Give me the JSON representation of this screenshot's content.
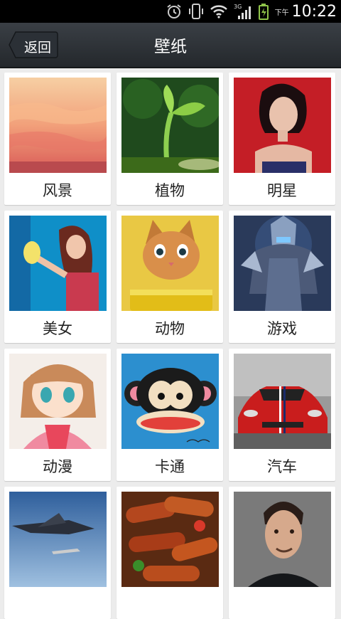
{
  "status_bar": {
    "ampm": "下午",
    "time": "10:22",
    "network": "3G",
    "icons": [
      "alarm-icon",
      "vibrate-icon",
      "wifi-icon",
      "signal-icon",
      "battery-icon"
    ]
  },
  "header": {
    "back_label": "返回",
    "title": "壁纸"
  },
  "categories": [
    {
      "label": "风景",
      "thumb": "sunset-landscape"
    },
    {
      "label": "植物",
      "thumb": "seedling-sprout"
    },
    {
      "label": "明星",
      "thumb": "celebrity-woman"
    },
    {
      "label": "美女",
      "thumb": "smiling-woman"
    },
    {
      "label": "动物",
      "thumb": "kitten"
    },
    {
      "label": "游戏",
      "thumb": "game-warrior"
    },
    {
      "label": "动漫",
      "thumb": "anime-girl"
    },
    {
      "label": "卡通",
      "thumb": "cartoon-monkey"
    },
    {
      "label": "汽车",
      "thumb": "red-sports-car"
    },
    {
      "label": "",
      "thumb": "jet-aircraft"
    },
    {
      "label": "",
      "thumb": "grilled-sausages"
    },
    {
      "label": "",
      "thumb": "man-portrait"
    }
  ]
}
